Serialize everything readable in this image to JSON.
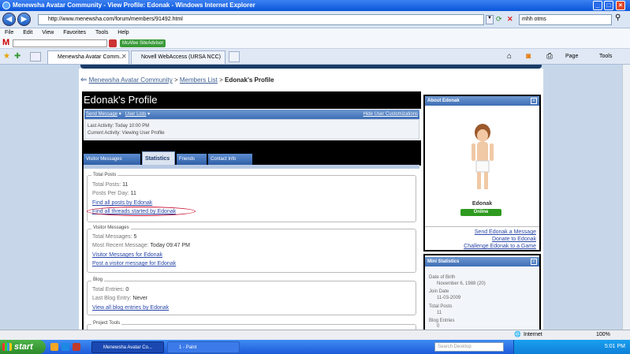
{
  "window": {
    "title": "Menewsha Avatar Community - View Profile: Edonak - Windows Internet Explorer"
  },
  "address": {
    "url": "http://www.menewsha.com/forum/members/91492.html",
    "search_value": "mhh otms"
  },
  "menu": [
    "File",
    "Edit",
    "View",
    "Favorites",
    "Tools",
    "Help"
  ],
  "toolbar": {
    "mcafee": "McAfee SiteAdvisor",
    "page": "Page",
    "tools": "Tools"
  },
  "tabs": [
    {
      "label": "Menewsha Avatar Comm..."
    },
    {
      "label": "Novell WebAccess (URSA NCC)"
    }
  ],
  "breadcrumb": {
    "home": "Menewsha Avatar Community",
    "sep1": ">",
    "list": "Members List",
    "sep2": ">",
    "current": "Edonak's Profile"
  },
  "profile": {
    "title": "Edonak's Profile",
    "send_message": "Send Message",
    "user_lists": "User Lists",
    "hide_custom": "Hide User Customizations",
    "last_activity": "Last Activity: Today 10:00 PM",
    "current_activity": "Current Activity: Viewing User Profile"
  },
  "profile_tabs": [
    "Visitor Messages",
    "Statistics",
    "Friends",
    "Contact Info"
  ],
  "stats": {
    "total_posts_legend": "Total Posts",
    "total_posts": "Total Posts:",
    "total_posts_val": "11",
    "per_day": "Posts Per Day:",
    "per_day_val": "11",
    "find_posts": "Find all posts by Edonak",
    "find_threads": "Find all threads started by Edonak",
    "vm_legend": "Visitor Messages",
    "total_messages": "Total Messages:",
    "total_messages_val": "5",
    "recent": "Most Recent Message:",
    "recent_val": "Today 09:47 PM",
    "vm_for": "Visitor Messages for Edonak",
    "post_vm": "Post a visitor message for Edonak",
    "blog_legend": "Blog",
    "entries": "Total Entries:",
    "entries_val": "0",
    "last_blog": "Last Blog Entry:",
    "last_blog_val": "Never",
    "view_blog": "View all blog entries by Edonak",
    "project_legend": "Project Tools"
  },
  "about": {
    "header": "About Edonak",
    "name": "Edonak",
    "online": "Online",
    "send_msg": "Send Edonak a Message",
    "donate": "Donate to Edonak",
    "challenge": "Challenge Edonak to a Game"
  },
  "mini": {
    "header": "Mini Statistics",
    "dob_label": "Date of Birth",
    "dob": "November 6, 1988 (20)",
    "join_label": "Join Date",
    "join": "11-03-2009",
    "posts_label": "Total Posts",
    "posts": "11",
    "blog_label": "Blog Entries",
    "blog": "0"
  },
  "statusbar": {
    "zone": "Internet",
    "zoom": "100%"
  },
  "taskbar": {
    "start": "start",
    "task1": "Menewsha Avatar Co...",
    "task2": "1 - Paint",
    "search": "Search Desktop",
    "clock": "5:01 PM"
  },
  "colors": {
    "accent": "#3e6eb6",
    "online": "#2e9a1f",
    "circle": "#cc1133"
  }
}
